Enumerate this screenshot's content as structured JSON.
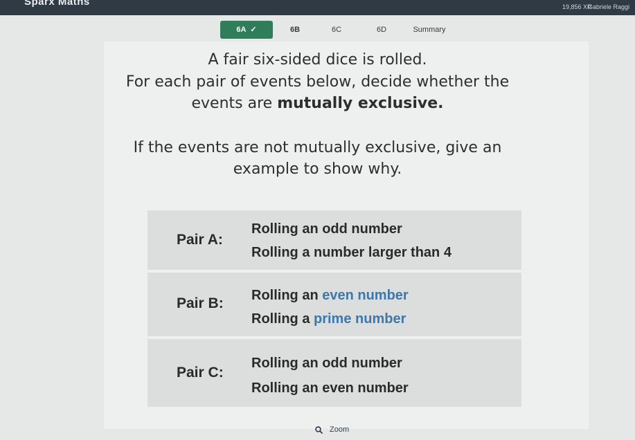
{
  "header": {
    "brand": "Sparx Maths",
    "xp": "19,856 XP",
    "user": "Gabriele Raggi"
  },
  "tabs": [
    {
      "label": "6A",
      "completed": true
    },
    {
      "label": "6B",
      "active": true
    },
    {
      "label": "6C"
    },
    {
      "label": "6D"
    },
    {
      "label": "Summary"
    }
  ],
  "question": {
    "line1": "A fair six-sided dice is rolled.",
    "line2": "For each pair of events below, decide whether the",
    "line3_start": "events are ",
    "line3_bold": "mutually exclusive.",
    "line4": "If the events are not mutually exclusive, give an",
    "line5": "example to show why."
  },
  "pairs": {
    "a": {
      "label": "Pair A:",
      "event1": "Rolling an odd number",
      "event2": "Rolling a number larger than 4"
    },
    "b": {
      "label": "Pair B:",
      "event1_start": "Rolling an ",
      "event1_hl": "even number",
      "event2_start": "Rolling a ",
      "event2_hl": "prime number"
    },
    "c": {
      "label": "Pair C:",
      "event1": "Rolling an odd number",
      "event2": "Rolling an even number"
    }
  },
  "zoom": {
    "label": "Zoom",
    "icon": "search-icon"
  },
  "colors": {
    "topbar": "#2f3a44",
    "tab_completed": "#2f7d5a",
    "highlight": "#3f77a8",
    "card": "#dcdedd"
  }
}
